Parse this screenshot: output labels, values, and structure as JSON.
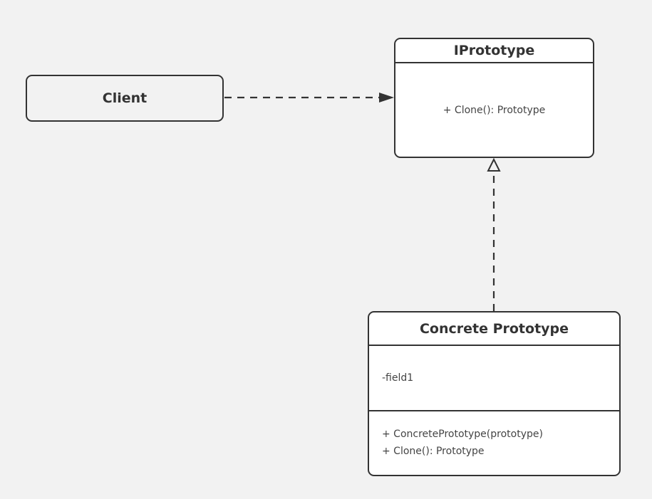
{
  "diagram": {
    "type": "UML class diagram",
    "nodes": {
      "client": {
        "label": "Client"
      },
      "iprototype": {
        "name": "IPrototype",
        "operations": [
          "+ Clone(): Prototype"
        ]
      },
      "concrete_prototype": {
        "name": "Concrete Prototype",
        "attributes": [
          "-field1"
        ],
        "operations": [
          "+ ConcretePrototype(prototype)",
          "+ Clone(): Prototype"
        ]
      }
    },
    "edges": [
      {
        "from": "Client",
        "to": "IPrototype",
        "kind": "dependency",
        "style": "dashed",
        "head": "filled-arrow"
      },
      {
        "from": "Concrete Prototype",
        "to": "IPrototype",
        "kind": "realization",
        "style": "dashed",
        "head": "hollow-triangle"
      }
    ],
    "colors": {
      "background": "#f2f2f2",
      "stroke": "#333333",
      "box_fill": "#ffffff"
    }
  }
}
